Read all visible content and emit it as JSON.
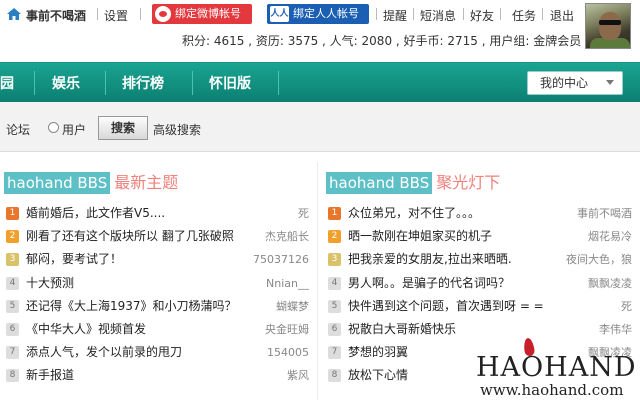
{
  "colors": {
    "nav_green": "#0f8f80",
    "brand_teal": "#5dc0c7",
    "title_coral": "#f0817b",
    "weibo_red": "#e3383e",
    "renren_blue": "#1a5fb3"
  },
  "topbar": {
    "username": "事前不喝酒",
    "settings": "设置",
    "weibo_button": "绑定微博帐号",
    "renren_logo": "人人",
    "renren_button": "绑定人人帐号",
    "links": [
      "提醒",
      "短消息",
      "好友",
      "任务",
      "退出"
    ],
    "stats": "积分: 4615 , 资历: 3575 , 人气: 2080 , 好手币: 2715 , 用户组: 金牌会员"
  },
  "nav": {
    "items": [
      "园",
      "娱乐",
      "排行榜",
      "怀旧版"
    ],
    "center_dropdown": "我的中心"
  },
  "search": {
    "forum_label": "论坛",
    "user_label": "用户",
    "search_button": "搜索",
    "advanced_link": "高级搜索"
  },
  "panels": [
    {
      "brand": "haohand BBS",
      "title": "最新主题",
      "items": [
        {
          "rank": "1",
          "title": "婚前婚后，此文作者V5....",
          "author": "死"
        },
        {
          "rank": "2",
          "title": "刚看了还有这个版块所以 翻了几张破照",
          "author": "杰克船长"
        },
        {
          "rank": "3",
          "title": "郁闷，要考试了！",
          "author": "75037126"
        },
        {
          "rank": "4",
          "title": "十大预测",
          "author": "Nnian__"
        },
        {
          "rank": "5",
          "title": "还记得《大上海1937》和小刀杨蒲吗？",
          "author": "蝴蝶梦"
        },
        {
          "rank": "6",
          "title": "《中华大人》视频首发",
          "author": "央金旺姆"
        },
        {
          "rank": "7",
          "title": "添点人气，发个以前录的甩刀",
          "author": "154005"
        },
        {
          "rank": "8",
          "title": "新手报道",
          "author": "紫风"
        }
      ]
    },
    {
      "brand": "haohand BBS",
      "title": "聚光灯下",
      "items": [
        {
          "rank": "1",
          "title": "众位弟兄，对不住了。。。",
          "author": "事前不喝酒"
        },
        {
          "rank": "2",
          "title": "晒一款刚在坤姐家买的机子",
          "author": "烟花易冷"
        },
        {
          "rank": "3",
          "title": "把我亲爱的女朋友,拉出来晒晒.",
          "author": "夜间大色，狼"
        },
        {
          "rank": "4",
          "title": "男人啊。。是骗子的代名词吗？",
          "author": "飘飘凌凌"
        },
        {
          "rank": "5",
          "title": "快件遇到这个问题，首次遇到呀 = =",
          "author": "死"
        },
        {
          "rank": "6",
          "title": "祝散白大哥新婚快乐",
          "author": "李伟华"
        },
        {
          "rank": "7",
          "title": "梦想的羽翼",
          "author": "飘飘凌凌"
        },
        {
          "rank": "8",
          "title": "放松下心情",
          "author": ""
        }
      ]
    }
  ],
  "watermark": {
    "logo": "HAOHAND",
    "url": "www.haohand.com"
  }
}
